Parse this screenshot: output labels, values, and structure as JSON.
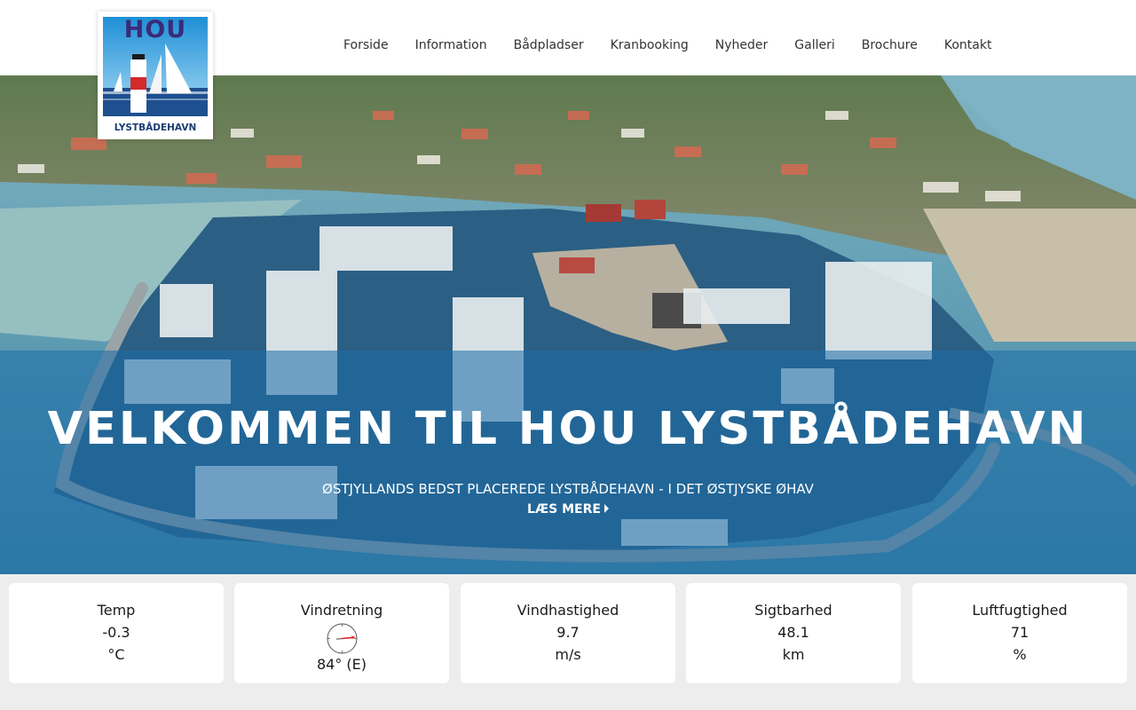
{
  "logo": {
    "word": "HOU",
    "subtitle": "LYSTBÅDEHAVN",
    "colors": {
      "sky": "#2a9bd8",
      "water": "#1e4f8f",
      "text": "#3b2a7a",
      "lighthouse_red": "#d32a2a"
    }
  },
  "nav": {
    "items": [
      {
        "label": "Forside"
      },
      {
        "label": "Information"
      },
      {
        "label": "Bådpladser"
      },
      {
        "label": "Kranbooking"
      },
      {
        "label": "Nyheder"
      },
      {
        "label": "Galleri"
      },
      {
        "label": "Brochure"
      },
      {
        "label": "Kontakt"
      }
    ]
  },
  "hero": {
    "title": "VELKOMMEN TIL HOU LYSTBÅDEHAVN",
    "subtitle": "ØSTJYLLANDS BEDST PLACEREDE LYSTBÅDEHAVN - I DET ØSTJYSKE ØHAV",
    "more_label": "LÆS MERE",
    "overlay_color": "#1c6ca8"
  },
  "weather": {
    "temp": {
      "label": "Temp",
      "value": "-0.3",
      "unit": "°C"
    },
    "wind_direction": {
      "label": "Vindretning",
      "degrees": 84,
      "text": "84° (E)"
    },
    "wind_speed": {
      "label": "Vindhastighed",
      "value": "9.7",
      "unit": "m/s"
    },
    "visibility": {
      "label": "Sigtbarhed",
      "value": "48.1",
      "unit": "km"
    },
    "humidity": {
      "label": "Luftfugtighed",
      "value": "71",
      "unit": "%"
    }
  }
}
